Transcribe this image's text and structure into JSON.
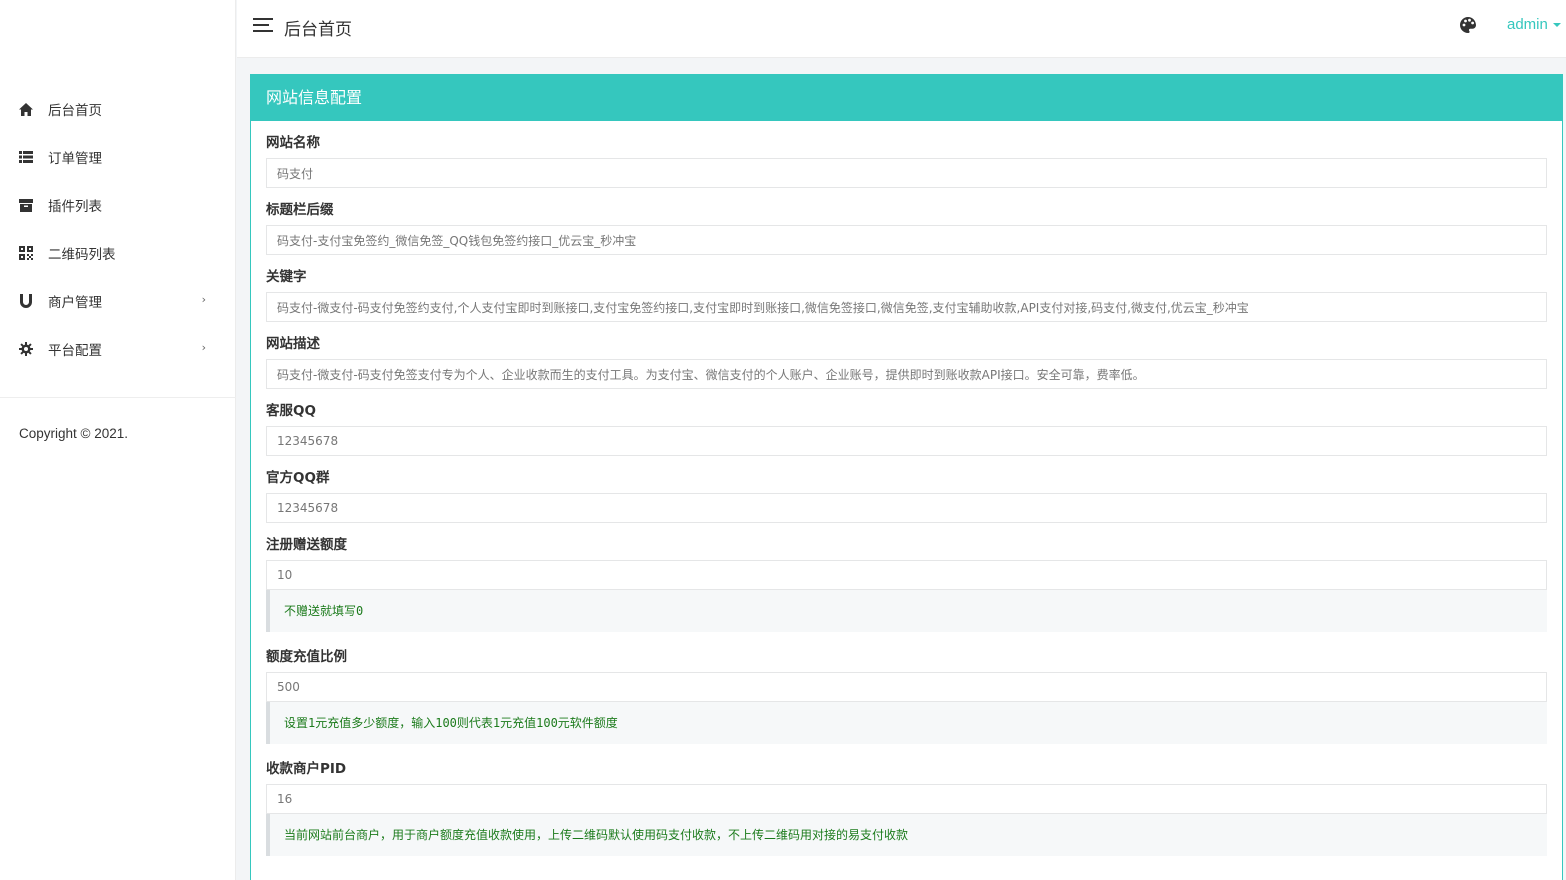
{
  "sidebar": {
    "items": [
      {
        "label": "后台首页",
        "icon": "home-icon",
        "has_children": false
      },
      {
        "label": "订单管理",
        "icon": "list-icon",
        "has_children": false
      },
      {
        "label": "插件列表",
        "icon": "archive-icon",
        "has_children": false
      },
      {
        "label": "二维码列表",
        "icon": "qrcode-icon",
        "has_children": false
      },
      {
        "label": "商户管理",
        "icon": "magnet-icon",
        "has_children": true
      },
      {
        "label": "平台配置",
        "icon": "gear-icon",
        "has_children": true
      }
    ],
    "chevron": "›",
    "copyright": "Copyright © 2021."
  },
  "header": {
    "title": "后台首页",
    "user": "admin",
    "theme_icon": "palette-icon"
  },
  "panel": {
    "title": "网站信息配置",
    "fields": [
      {
        "label": "网站名称",
        "value": "码支付"
      },
      {
        "label": "标题栏后缀",
        "value": "码支付-支付宝免签约_微信免签_QQ钱包免签约接口_优云宝_秒冲宝"
      },
      {
        "label": "关键字",
        "value": "码支付-微支付-码支付免签约支付,个人支付宝即时到账接口,支付宝免签约接口,支付宝即时到账接口,微信免签接口,微信免签,支付宝辅助收款,API支付对接,码支付,微支付,优云宝_秒冲宝"
      },
      {
        "label": "网站描述",
        "value": "码支付-微支付-码支付免签支付专为个人、企业收款而生的支付工具。为支付宝、微信支付的个人账户、企业账号，提供即时到账收款API接口。安全可靠，费率低。"
      },
      {
        "label": "客服QQ",
        "value": "12345678"
      },
      {
        "label": "官方QQ群",
        "value": "12345678"
      },
      {
        "label": "注册赠送额度",
        "value": "10",
        "hint": "不赠送就填写0"
      },
      {
        "label": "额度充值比例",
        "value": "500",
        "hint": "设置1元充值多少额度，输入100则代表1元充值100元软件额度"
      },
      {
        "label": "收款商户PID",
        "value": "16",
        "hint": "当前网站前台商户，用于商户额度充值收款使用，上传二维码默认使用码支付收款，不上传二维码用对接的易支付收款"
      }
    ]
  },
  "colors": {
    "accent": "#35c7be",
    "hint_text": "#1c7b1c"
  }
}
